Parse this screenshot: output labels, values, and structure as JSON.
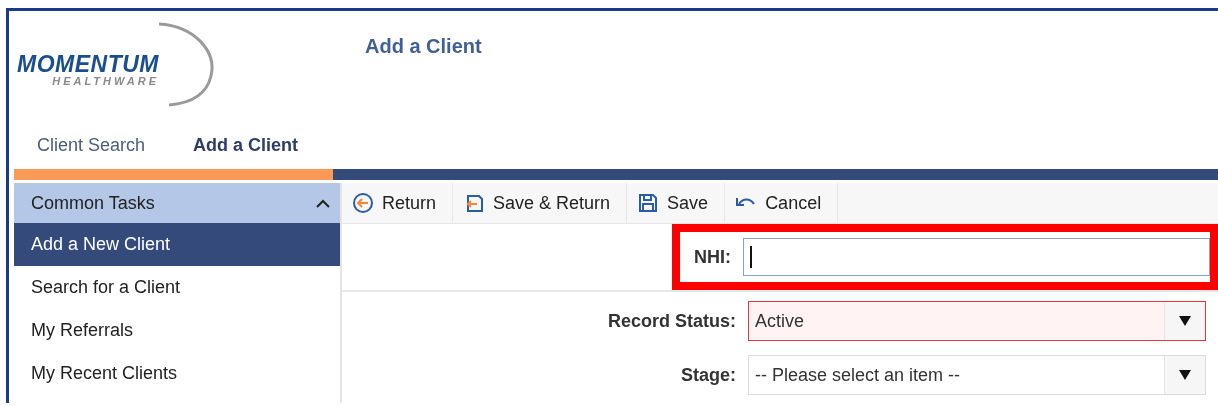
{
  "logo": {
    "name": "MOMENTUM",
    "tagline": "HEALTHWARE"
  },
  "page_title": "Add a Client",
  "tabs": [
    {
      "label": "Client Search",
      "selected": false
    },
    {
      "label": "Add a Client",
      "selected": true
    }
  ],
  "sidebar": {
    "header": "Common Tasks",
    "expanded": true,
    "items": [
      {
        "label": "Add a New Client",
        "selected": true
      },
      {
        "label": "Search for a Client",
        "selected": false
      },
      {
        "label": "My Referrals",
        "selected": false
      },
      {
        "label": "My Recent Clients",
        "selected": false
      }
    ]
  },
  "toolbar": [
    {
      "kind": "return",
      "label": "Return"
    },
    {
      "kind": "save-return",
      "label": "Save & Return"
    },
    {
      "kind": "save",
      "label": "Save"
    },
    {
      "kind": "cancel",
      "label": "Cancel"
    }
  ],
  "form": {
    "fields": [
      {
        "kind": "text",
        "label": "NHI:",
        "highlighted": true,
        "focused": true
      },
      {
        "kind": "select",
        "label": "Record Status:",
        "value": "Active",
        "invalid": true
      },
      {
        "kind": "select",
        "label": "Stage:",
        "placeholder": "-- Please select an item --",
        "invalid": false
      }
    ]
  }
}
